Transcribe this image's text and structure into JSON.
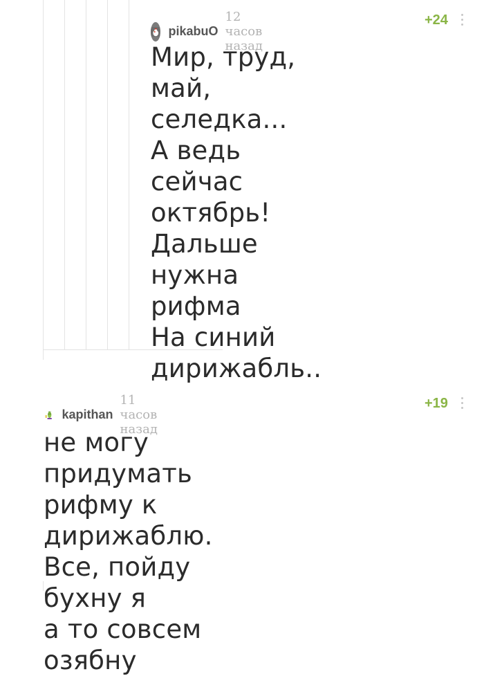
{
  "comments": [
    {
      "author": "pikabuO",
      "time": "12 часов назад",
      "rating": "+24",
      "text": "Мир, труд, май,\nселедка...\nА ведь сейчас\nоктябрь!\nДальше нужна\nрифма\nНа синий\nдирижабль..",
      "avatar_icon": "rooster-avatar-icon"
    },
    {
      "author": "kapithan",
      "time": "11 часов назад",
      "rating": "+19",
      "text": "не могу придумать\nрифму к дирижаблю.\nВсе, пойду бухну я\nа то совсем озябну",
      "avatar_icon": "cactus-avatar-icon"
    }
  ],
  "colors": {
    "rating": "#8ab546",
    "thread_line": "#e3e3e3",
    "author": "#555555",
    "time": "#b3b3b3"
  }
}
